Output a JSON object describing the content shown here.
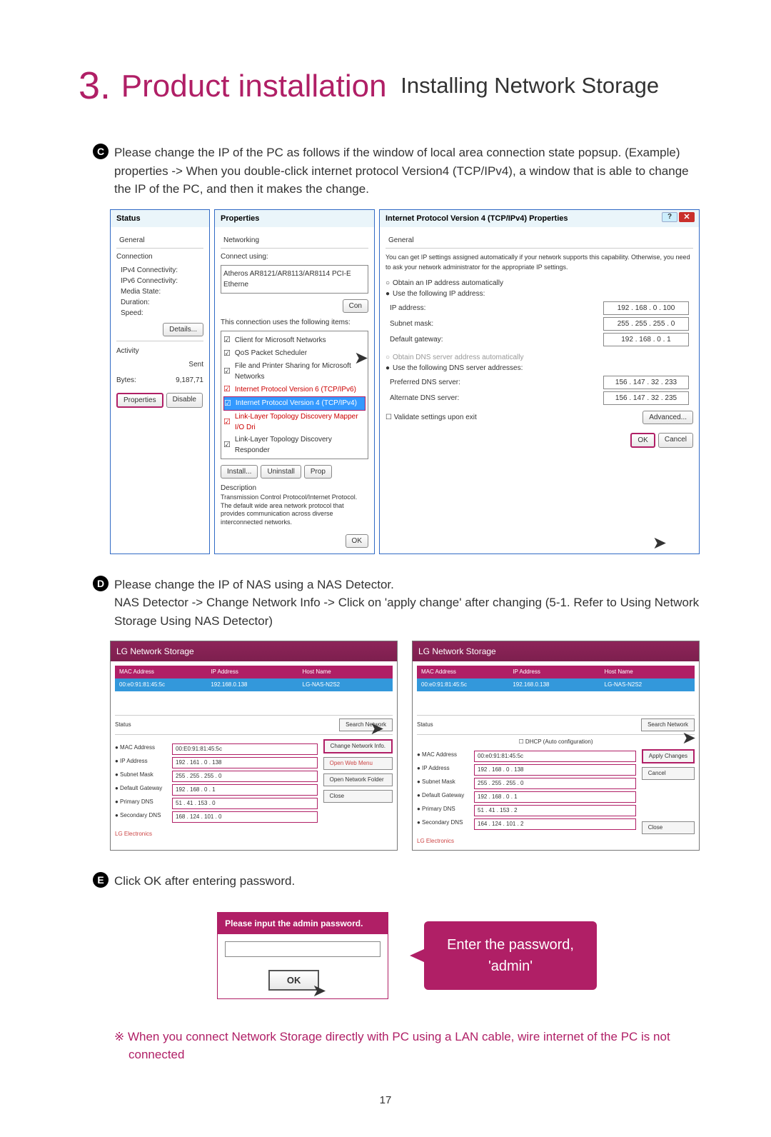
{
  "chapter": {
    "number": "3.",
    "title": "Product installation",
    "subtitle": "Installing Network Storage"
  },
  "page_number": "17",
  "steps": {
    "c": {
      "marker": "C",
      "line1": "Please change the IP of the PC as follows if the window of local area connection state popsup. (Example)",
      "line2": "properties -> When you double-click internet protocol Version4 (TCP/IPv4), a window that is able to change the IP of the PC, and then it makes the change."
    },
    "d": {
      "marker": "D",
      "line1": "Please change the IP of NAS using a NAS Detector.",
      "line2": "NAS Detector -> Change Network Info -> Click on 'apply change' after changing (5-1. Refer to Using Network Storage Using NAS Detector)"
    },
    "e": {
      "marker": "E",
      "line1": "Click OK after entering password."
    }
  },
  "status_window": {
    "title": "Status",
    "tab": "General",
    "connection_label": "Connection",
    "labels": {
      "ipv4": "IPv4 Connectivity:",
      "ipv6": "IPv6 Connectivity:",
      "media": "Media State:",
      "duration": "Duration:",
      "speed": "Speed:"
    },
    "details_btn": "Details...",
    "activity_label": "Activity",
    "sent_label": "Sent",
    "bytes_label": "Bytes:",
    "bytes_value": "9,187,71",
    "properties_btn": "Properties",
    "disable_btn": "Disable"
  },
  "properties_window": {
    "title": "Properties",
    "tab": "Networking",
    "connect_using": "Connect using:",
    "adapter": "Atheros AR8121/AR8113/AR8114 PCI-E Etherne",
    "configure_btn": "Con",
    "items_label": "This connection uses the following items:",
    "items": [
      "Client for Microsoft Networks",
      "QoS Packet Scheduler",
      "File and Printer Sharing for Microsoft Networks",
      "Internet Protocol Version 6 (TCP/IPv6)",
      "Internet Protocol Version 4 (TCP/IPv4)",
      "Link-Layer Topology Discovery Mapper I/O Dri",
      "Link-Layer Topology Discovery Responder"
    ],
    "install_btn": "Install...",
    "uninstall_btn": "Uninstall",
    "props_btn": "Prop",
    "desc_label": "Description",
    "desc_text": "Transmission Control Protocol/Internet Protocol. The default wide area network protocol that provides communication across diverse interconnected networks.",
    "ok_btn": "OK"
  },
  "ipv4_window": {
    "title": "Internet Protocol Version 4 (TCP/IPv4) Properties",
    "tab": "General",
    "info": "You can get IP settings assigned automatically if your network supports this capability. Otherwise, you need to ask your network administrator for the appropriate IP settings.",
    "radio_auto": "Obtain an IP address automatically",
    "radio_manual": "Use the following IP address:",
    "ip_label": "IP address:",
    "ip_val": "192 . 168 . 0 . 100",
    "subnet_label": "Subnet mask:",
    "subnet_val": "255 . 255 . 255 . 0",
    "gateway_label": "Default gateway:",
    "gateway_val": "192 . 168 . 0 . 1",
    "dns_auto": "Obtain DNS server address automatically",
    "dns_manual": "Use the following DNS server addresses:",
    "dns1_label": "Preferred DNS server:",
    "dns1_val": "156 . 147 . 32 . 233",
    "dns2_label": "Alternate DNS server:",
    "dns2_val": "156 . 147 . 32 . 235",
    "validate": "Validate settings upon exit",
    "advanced_btn": "Advanced...",
    "ok_btn": "OK",
    "cancel_btn": "Cancel"
  },
  "nas1": {
    "title": "LG Network Storage",
    "col_mac": "MAC Address",
    "col_ip": "IP Address",
    "col_host": "Host Name",
    "row_mac": "00:e0:91:81:45:5c",
    "row_ip": "192.168.0.138",
    "row_host": "LG-NAS-N2S2",
    "status_label": "Status",
    "search_btn": "Search Network",
    "f_mac": "● MAC Address",
    "v_mac": "00:E0:91:81:45:5c",
    "f_ip": "● IP Address",
    "v_ip": "192 . 161 . 0 . 138",
    "f_sub": "● Subnet Mask",
    "v_sub": "255 . 255 . 255 . 0",
    "f_gw": "● Default Gateway",
    "v_gw": "192 . 168 . 0 . 1",
    "f_dns1": "● Primary DNS",
    "v_dns1": "51 . 41 . 153 . 0",
    "f_dns2": "● Secondary DNS",
    "v_dns2": "168 . 124 . 101 . 0",
    "change_btn": "Change Network Info.",
    "open_web": "Open Web Menu",
    "open_folder": "Open Network Folder",
    "close_btn": "Close",
    "footer": "LG Electronics"
  },
  "nas2": {
    "title": "LG Network Storage",
    "col_mac": "MAC Address",
    "col_ip": "IP Address",
    "col_host": "Host Name",
    "row_mac": "00:e0:91:81:45:5c",
    "row_ip": "192.168.0.138",
    "row_host": "LG-NAS-N2S2",
    "status_label": "Status",
    "search_btn": "Search Network",
    "dhcp_label": "DHCP (Auto configuration)",
    "f_mac": "● MAC Address",
    "v_mac": "00:e0:91:81:45:5c",
    "f_ip": "● IP Address",
    "v_ip": "192 . 168 . 0 . 138",
    "f_sub": "● Subnet Mask",
    "v_sub": "255 . 255 . 255 . 0",
    "f_gw": "● Default Gateway",
    "v_gw": "192 . 168 . 0 . 1",
    "f_dns1": "● Primary DNS",
    "v_dns1": "51 . 41 . 153 . 2",
    "f_dns2": "● Secondary DNS",
    "v_dns2": "164 . 124 . 101 . 2",
    "apply_btn": "Apply Changes",
    "cancel_btn": "Cancel",
    "close_btn": "Close",
    "footer": "LG Electronics"
  },
  "pw_dialog": {
    "header": "Please input the admin password.",
    "ok": "OK",
    "callout_l1": "Enter the password,",
    "callout_l2": "'admin'"
  },
  "note": "※ When you connect Network Storage directly with PC using a LAN cable, wire internet of the PC is not connected"
}
